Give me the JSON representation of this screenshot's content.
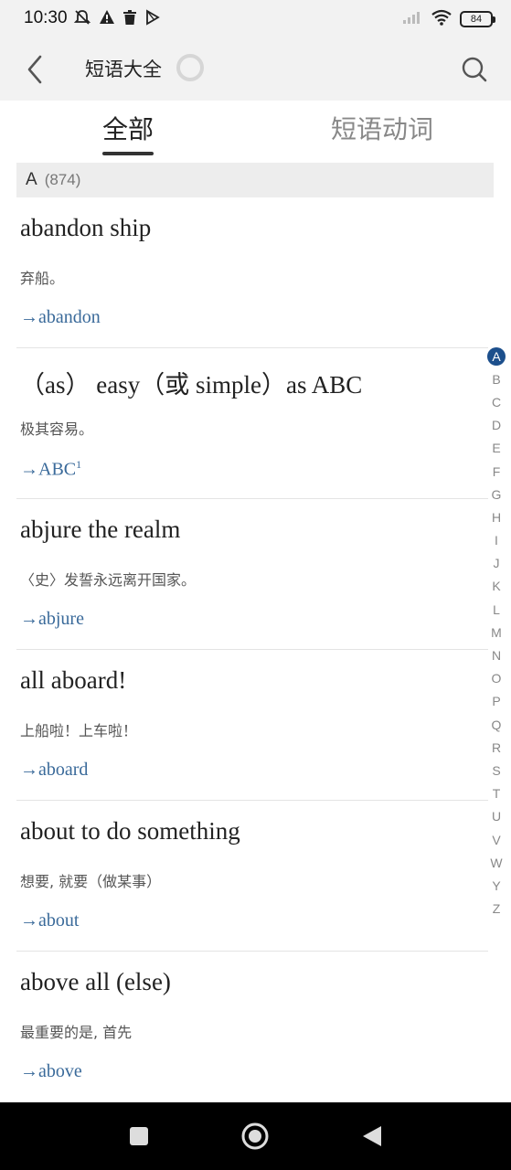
{
  "status": {
    "time": "10:30",
    "battery": "84"
  },
  "header": {
    "title": "短语大全"
  },
  "tabs": [
    {
      "label": "全部",
      "active": true
    },
    {
      "label": "短语动词",
      "active": false
    }
  ],
  "section": {
    "letter": "A",
    "count": "(874)"
  },
  "entries": [
    {
      "phrase": "abandon ship",
      "definition": "弃船。",
      "link": "→abandon",
      "sup": ""
    },
    {
      "phrase": "（as） easy（或 simple）as ABC",
      "definition": "极其容易。",
      "link": "→ABC",
      "sup": "1"
    },
    {
      "phrase": "abjure the realm",
      "definition": "〈史〉发誓永远离开国家。",
      "link": "→abjure",
      "sup": ""
    },
    {
      "phrase": "all aboard!",
      "definition": "上船啦！上车啦！",
      "link": "→aboard",
      "sup": ""
    },
    {
      "phrase": "about to do something",
      "definition": "想要, 就要（做某事）",
      "link": "→about",
      "sup": ""
    },
    {
      "phrase": "above all (else)",
      "definition": "最重要的是, 首先",
      "link": "→above",
      "sup": ""
    }
  ],
  "alphabet": [
    "A",
    "B",
    "C",
    "D",
    "E",
    "F",
    "G",
    "H",
    "I",
    "J",
    "K",
    "L",
    "M",
    "N",
    "O",
    "P",
    "Q",
    "R",
    "S",
    "T",
    "U",
    "V",
    "W",
    "Y",
    "Z"
  ],
  "alphabet_active": "A",
  "colors": {
    "link": "#3a6a9a",
    "index_active": "#1c4f8c"
  }
}
